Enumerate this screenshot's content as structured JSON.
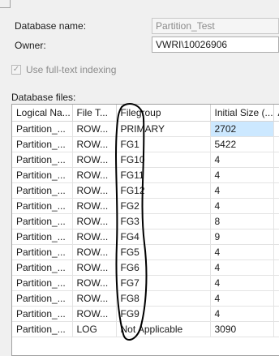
{
  "general": {
    "database_name_label": "Database name:",
    "database_name_value": "Partition_Test",
    "owner_label": "Owner:",
    "owner_value": "VWRI\\10026906",
    "fulltext_label": "Use full-text indexing",
    "fulltext_checked": true
  },
  "files": {
    "section_label": "Database files:",
    "columns": [
      "Logical Na...",
      "File T...",
      "Filegroup",
      "Initial Size (...",
      "A"
    ],
    "rows": [
      {
        "logical": "Partition_...",
        "type": "ROW...",
        "filegroup": "PRIMARY",
        "size": "2702"
      },
      {
        "logical": "Partition_...",
        "type": "ROW...",
        "filegroup": "FG1",
        "size": "5422"
      },
      {
        "logical": "Partition_...",
        "type": "ROW...",
        "filegroup": "FG10",
        "size": "4"
      },
      {
        "logical": "Partition_...",
        "type": "ROW...",
        "filegroup": "FG11",
        "size": "4"
      },
      {
        "logical": "Partition_...",
        "type": "ROW...",
        "filegroup": "FG12",
        "size": "4"
      },
      {
        "logical": "Partition_...",
        "type": "ROW...",
        "filegroup": "FG2",
        "size": "4"
      },
      {
        "logical": "Partition_...",
        "type": "ROW...",
        "filegroup": "FG3",
        "size": "8"
      },
      {
        "logical": "Partition_...",
        "type": "ROW...",
        "filegroup": "FG4",
        "size": "9"
      },
      {
        "logical": "Partition_...",
        "type": "ROW...",
        "filegroup": "FG5",
        "size": "4"
      },
      {
        "logical": "Partition_...",
        "type": "ROW...",
        "filegroup": "FG6",
        "size": "4"
      },
      {
        "logical": "Partition_...",
        "type": "ROW...",
        "filegroup": "FG7",
        "size": "4"
      },
      {
        "logical": "Partition_...",
        "type": "ROW...",
        "filegroup": "FG8",
        "size": "4"
      },
      {
        "logical": "Partition_...",
        "type": "ROW...",
        "filegroup": "FG9",
        "size": "4"
      },
      {
        "logical": "Partition_...",
        "type": "LOG",
        "filegroup": "Not Applicable",
        "size": "3090"
      }
    ]
  },
  "colors": {
    "selection": "#cce8ff",
    "annotation_ink": "#000000",
    "autogrowth_marker": "#7a2330"
  }
}
